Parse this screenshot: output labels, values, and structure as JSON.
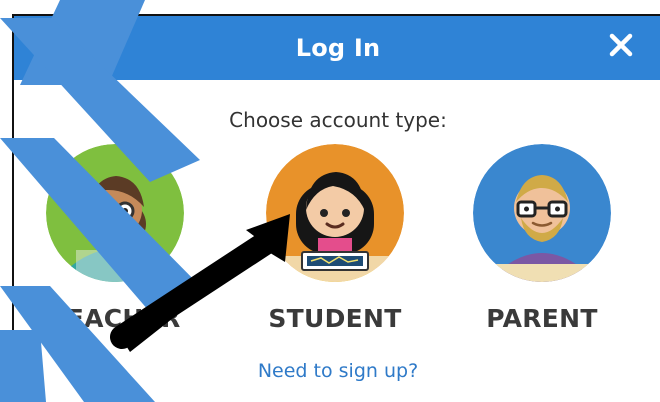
{
  "dialog": {
    "title": "Log In",
    "close_symbol": "×",
    "prompt": "Choose account type:",
    "signup_link": "Need to sign up?"
  },
  "account_types": [
    {
      "label": "TEACHER",
      "bg": "#7fbf3f"
    },
    {
      "label": "STUDENT",
      "bg": "#e8922a"
    },
    {
      "label": "PARENT",
      "bg": "#3a87cf"
    }
  ],
  "colors": {
    "header": "#2f83d6",
    "link": "#2f7ac8",
    "annotation_blue": "#4a90d9",
    "annotation_arrow": "#000000"
  },
  "icons": [
    "close-icon",
    "teacher-avatar-icon",
    "student-avatar-icon",
    "parent-avatar-icon",
    "annotation-arrow-icon"
  ]
}
